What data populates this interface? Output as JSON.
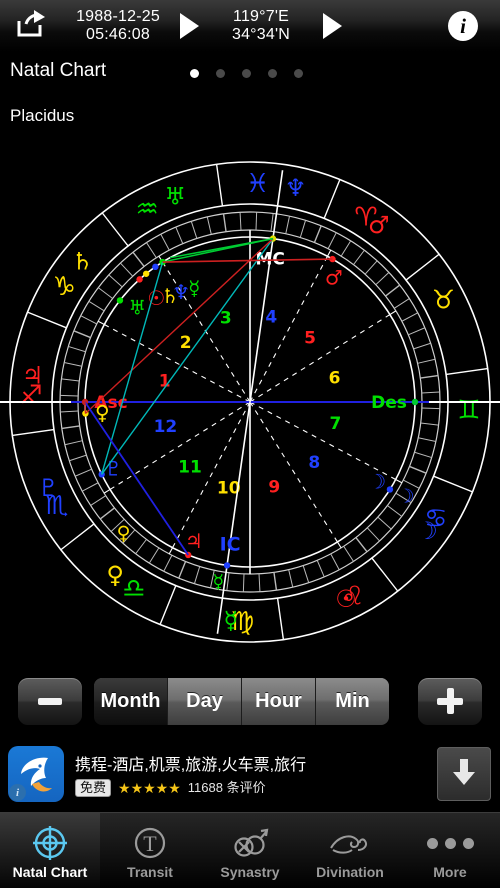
{
  "topbar": {
    "share_icon": "share-icon",
    "datetime": {
      "date": "1988-12-25",
      "time": "05:46:08"
    },
    "datetime_next_icon": "play-triangle-icon",
    "location": {
      "longitude": "119°7'E",
      "latitude": "34°34'N"
    },
    "location_next_icon": "play-triangle-icon",
    "info_icon": "info-icon",
    "info_glyph": "i"
  },
  "header": {
    "title": "Natal Chart",
    "house_system": "Placidus",
    "page_dots": {
      "count": 5,
      "active_index": 0
    }
  },
  "chart": {
    "type": "natal-wheel",
    "asc_label": "Asc",
    "des_label": "Des",
    "mc_label": "MC",
    "ic_label": "IC",
    "zodiac_signs": [
      {
        "name": "Aries",
        "glyph": "♈",
        "color": "#ff2020"
      },
      {
        "name": "Taurus",
        "glyph": "♉",
        "color": "#ffe000"
      },
      {
        "name": "Gemini",
        "glyph": "♊",
        "color": "#00e000"
      },
      {
        "name": "Cancer",
        "glyph": "♋",
        "color": "#2040ff"
      },
      {
        "name": "Leo",
        "glyph": "♌",
        "color": "#ff2020"
      },
      {
        "name": "Virgo",
        "glyph": "♍",
        "color": "#ffe000"
      },
      {
        "name": "Libra",
        "glyph": "♎",
        "color": "#00e000"
      },
      {
        "name": "Scorpio",
        "glyph": "♏",
        "color": "#2040ff"
      },
      {
        "name": "Sagittarius",
        "glyph": "♐",
        "color": "#ff2020"
      },
      {
        "name": "Capricorn",
        "glyph": "♑",
        "color": "#ffe000"
      },
      {
        "name": "Aquarius",
        "glyph": "♒",
        "color": "#00e000"
      },
      {
        "name": "Pisces",
        "glyph": "♓",
        "color": "#2040ff"
      }
    ],
    "planets": [
      {
        "name": "Sun",
        "glyph": "☉",
        "color": "#ff2020",
        "sign": "Leo"
      },
      {
        "name": "Moon",
        "glyph": "☽",
        "color": "#2040ff",
        "sign": "Cancer"
      },
      {
        "name": "Mercury",
        "glyph": "☿",
        "color": "#00e000",
        "sign": "Virgo"
      },
      {
        "name": "Venus",
        "glyph": "♀",
        "color": "#ffe000",
        "sign": "Libra"
      },
      {
        "name": "Mars",
        "glyph": "♂",
        "color": "#ff2020",
        "sign": "Aries"
      },
      {
        "name": "Jupiter",
        "glyph": "♃",
        "color": "#ff2020",
        "sign": "Sagittarius"
      },
      {
        "name": "Saturn",
        "glyph": "♄",
        "color": "#ffe000",
        "sign": "Capricorn"
      },
      {
        "name": "Uranus",
        "glyph": "♅",
        "color": "#00e000",
        "sign": "Aquarius"
      },
      {
        "name": "Neptune",
        "glyph": "♆",
        "color": "#2040ff",
        "sign": "Pisces"
      },
      {
        "name": "Pluto",
        "glyph": "♇",
        "color": "#2040ff",
        "sign": "Scorpio"
      }
    ],
    "house_numbers": [
      {
        "number": "1",
        "color": "#ff2020"
      },
      {
        "number": "2",
        "color": "#ffe000"
      },
      {
        "number": "3",
        "color": "#00e000"
      },
      {
        "number": "4",
        "color": "#2040ff"
      },
      {
        "number": "5",
        "color": "#ff2020"
      },
      {
        "number": "6",
        "color": "#ffe000"
      },
      {
        "number": "7",
        "color": "#00e000"
      },
      {
        "number": "8",
        "color": "#2040ff"
      },
      {
        "number": "9",
        "color": "#ff2020"
      },
      {
        "number": "10",
        "color": "#ffe000"
      },
      {
        "number": "11",
        "color": "#00e000"
      },
      {
        "number": "12",
        "color": "#2040ff"
      }
    ],
    "aspect_colors": {
      "trine": "#00cc33",
      "sextile": "#00b8b8",
      "opposition": "#cc2020",
      "axis": "#2020e0",
      "conjunction": "#cc2020"
    }
  },
  "stepper": {
    "decrement_label": "−",
    "decrement_icon": "minus-icon",
    "increment_label": "+",
    "increment_icon": "plus-icon",
    "segments": [
      {
        "label": "Month",
        "selected": true
      },
      {
        "label": "Day",
        "selected": false
      },
      {
        "label": "Hour",
        "selected": false
      },
      {
        "label": "Min",
        "selected": false
      }
    ]
  },
  "ad": {
    "icon_name": "dolphin-app-icon",
    "info_badge": "i",
    "title": "携程-酒店,机票,旅游,火车票,旅行",
    "price_badge": "免费",
    "stars": "★★★★★",
    "rating": 4.5,
    "reviews": "11688 条评价",
    "download_icon": "download-arrow-icon"
  },
  "tabbar": {
    "items": [
      {
        "label": "Natal Chart",
        "icon": "crosshair-icon",
        "active": true
      },
      {
        "label": "Transit",
        "icon": "letter-t-icon",
        "active": false
      },
      {
        "label": "Synastry",
        "icon": "mars-venus-icon",
        "active": false
      },
      {
        "label": "Divination",
        "icon": "cloud-swirl-icon",
        "active": false
      },
      {
        "label": "More",
        "icon": "ellipsis-icon",
        "active": false
      }
    ]
  }
}
